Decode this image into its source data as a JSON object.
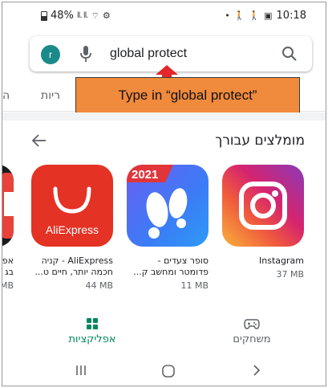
{
  "status_bar": {
    "battery": "48%",
    "time": "10:18",
    "signal_text": "ll. ll."
  },
  "search": {
    "avatar_letter": "r",
    "query": "global protect"
  },
  "tabs": {
    "left_cut": "ה",
    "partial": "ריות"
  },
  "annotation": {
    "text": "Type in “global protect”"
  },
  "section": {
    "title": "מומלצים עבורך"
  },
  "apps": [
    {
      "name_line1": "Instagram",
      "name_line2": "",
      "size": "37 MB",
      "icon": "instagram-icon"
    },
    {
      "name_line1": "סופר צעדים -",
      "name_line2": "פדומטר ומחשב ק...",
      "size": "11 MB",
      "icon": "step-counter-icon",
      "badge": "2021"
    },
    {
      "name_line1": "AliExpress - קניה",
      "name_line2": "חכמה יותר, חיים ט...",
      "size": "44 MB",
      "icon": "aliexpress-icon",
      "logo_text": "AliExpress"
    },
    {
      "name_line1": "אפ",
      "name_line2": "בג",
      "size": "MB",
      "icon": "partial-app-icon"
    }
  ],
  "bottom_nav": {
    "games": "משחקים",
    "apps": "אפליקציות"
  },
  "colors": {
    "accent_green": "#01875f",
    "annotation_bg": "#f08a3c",
    "arrow_red": "#e3262b"
  }
}
